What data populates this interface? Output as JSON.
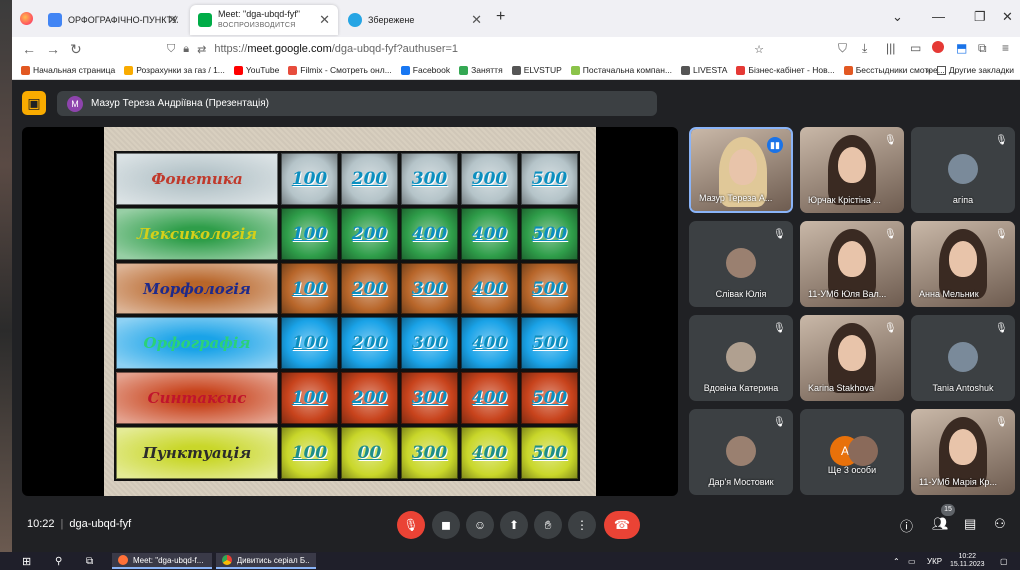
{
  "browser": {
    "tabs": [
      {
        "title": "ОРФОГРАФІЧНО-ПУНКТУАЦІЙ",
        "fav": "#4285f4"
      },
      {
        "title": "Meet: \"dga-ubqd-fyf\"",
        "subtitle": "ВОСПРОИЗВОДИТСЯ",
        "fav": "#00ac47"
      },
      {
        "title": "Збережене",
        "fav": "#26a5e4"
      }
    ],
    "new_tab": "+",
    "url_prefix": "https://",
    "url_domain": "meet.google.com",
    "url_path": "/dga-ubqd-fyf?authuser=1",
    "bookmarks": [
      {
        "label": "Начальная страница",
        "color": "#e25822"
      },
      {
        "label": "Розрахунки за газ / 1...",
        "color": "#f9ab00"
      },
      {
        "label": "YouTube",
        "color": "#ff0000"
      },
      {
        "label": "Filmix - Смотреть онл...",
        "color": "#e74c3c"
      },
      {
        "label": "Facebook",
        "color": "#1877f2"
      },
      {
        "label": "Заняття",
        "color": "#34a853"
      },
      {
        "label": "ELVSTUP",
        "color": "#555555"
      },
      {
        "label": "Постачальна компан...",
        "color": "#8bc34a"
      },
      {
        "label": "LIVESTA",
        "color": "#555555"
      },
      {
        "label": "Бізнес-кабінет - Нов...",
        "color": "#e53935"
      },
      {
        "label": "Бесстыдники смотре...",
        "color": "#e25822"
      }
    ],
    "other_bookmarks": "Другие закладки"
  },
  "meet": {
    "presenter": "Мазур Тереза Андріївна (Презентація)",
    "presenter_initial": "M",
    "time": "10:22",
    "code": "dga-ubqd-fyf",
    "participants_count": "15",
    "participants": [
      {
        "name": "Мазур Тереза А...",
        "speaking": true
      },
      {
        "name": "Юрчак Крістіна ..."
      },
      {
        "name": "агіпа"
      },
      {
        "name": "Слівак Юлія"
      },
      {
        "name": "11-УМб Юля Вал..."
      },
      {
        "name": "Анна Мельник"
      },
      {
        "name": "Вдовіна Катерина"
      },
      {
        "name": "Karina Stakhova"
      },
      {
        "name": "Tania Antoshuk"
      },
      {
        "name": "Дар'я Мостовик"
      },
      {
        "name": "Ще 3 особи",
        "initial": "А"
      },
      {
        "name": "11-УМб Марія Кр..."
      }
    ]
  },
  "game": {
    "categories": [
      "Фонетика",
      "Лексикологія",
      "Морфологія",
      "Орфографія",
      "Синтаксис",
      "Пунктуація"
    ],
    "category_colors": [
      "#c0392b",
      "#d4d01a",
      "#1f2a8a",
      "#2bd17a",
      "#c0142c",
      "#2b2b2b"
    ],
    "row_bg": [
      "#b5c4c9",
      "#2f9e4a",
      "#b8662a",
      "#1aa3e8",
      "#c8431c",
      "#c9d72a"
    ],
    "points": [
      [
        "100",
        "200",
        "300",
        "900",
        "500"
      ],
      [
        "100",
        "200",
        "400",
        "400",
        "500"
      ],
      [
        "100",
        "200",
        "300",
        "400",
        "500"
      ],
      [
        "100",
        "200",
        "300",
        "400",
        "500"
      ],
      [
        "100",
        "200",
        "300",
        "400",
        "500"
      ],
      [
        "100",
        "00",
        "300",
        "400",
        "500"
      ]
    ]
  },
  "taskbar": {
    "apps": [
      "Meet: \"dga-ubqd-f...",
      "Дивитись серіал Б..."
    ],
    "lang": "УКР",
    "clock": "10:22",
    "date": "15.11.2023"
  }
}
